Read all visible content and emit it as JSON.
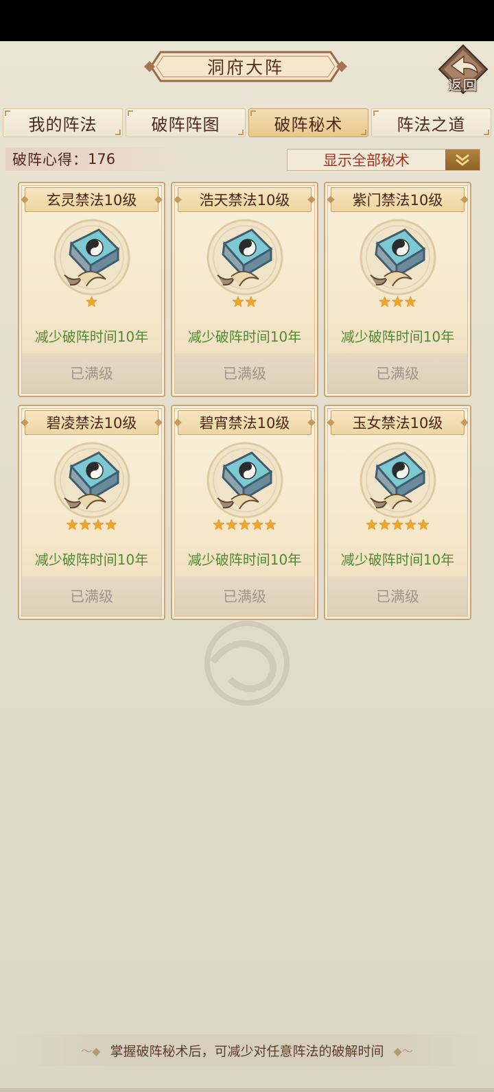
{
  "header": {
    "title": "洞府大阵",
    "back_label": "返回"
  },
  "tabs": [
    {
      "label": "我的阵法",
      "active": false
    },
    {
      "label": "破阵阵图",
      "active": false
    },
    {
      "label": "破阵秘术",
      "active": true
    },
    {
      "label": "阵法之道",
      "active": false
    }
  ],
  "info": {
    "points_label": "破阵心得：",
    "points_value": "176",
    "filter_label": "显示全部秘术"
  },
  "cards": [
    {
      "title": "玄灵禁法10级",
      "stars": 1,
      "effect": "减少破阵时间10年",
      "status": "已满级"
    },
    {
      "title": "浩天禁法10级",
      "stars": 2,
      "effect": "减少破阵时间10年",
      "status": "已满级"
    },
    {
      "title": "紫门禁法10级",
      "stars": 3,
      "effect": "减少破阵时间10年",
      "status": "已满级"
    },
    {
      "title": "碧凌禁法10级",
      "stars": 4,
      "effect": "减少破阵时间10年",
      "status": "已满级"
    },
    {
      "title": "碧宵禁法10级",
      "stars": 5,
      "effect": "减少破阵时间10年",
      "status": "已满级"
    },
    {
      "title": "玉女禁法10级",
      "stars": 5,
      "effect": "减少破阵时间10年",
      "status": "已满级"
    }
  ],
  "footer": {
    "hint": "掌握破阵秘术后，可减少对任意阵法的破解时间"
  },
  "icons": {
    "card_icon": "taiji-book-icon",
    "back": "back-arrow-icon",
    "filter": "chevron-double-down-icon",
    "star": "star-icon"
  },
  "colors": {
    "effect_text": "#4e8a32",
    "filter_text": "#a5321e",
    "star": "#f4a623"
  }
}
